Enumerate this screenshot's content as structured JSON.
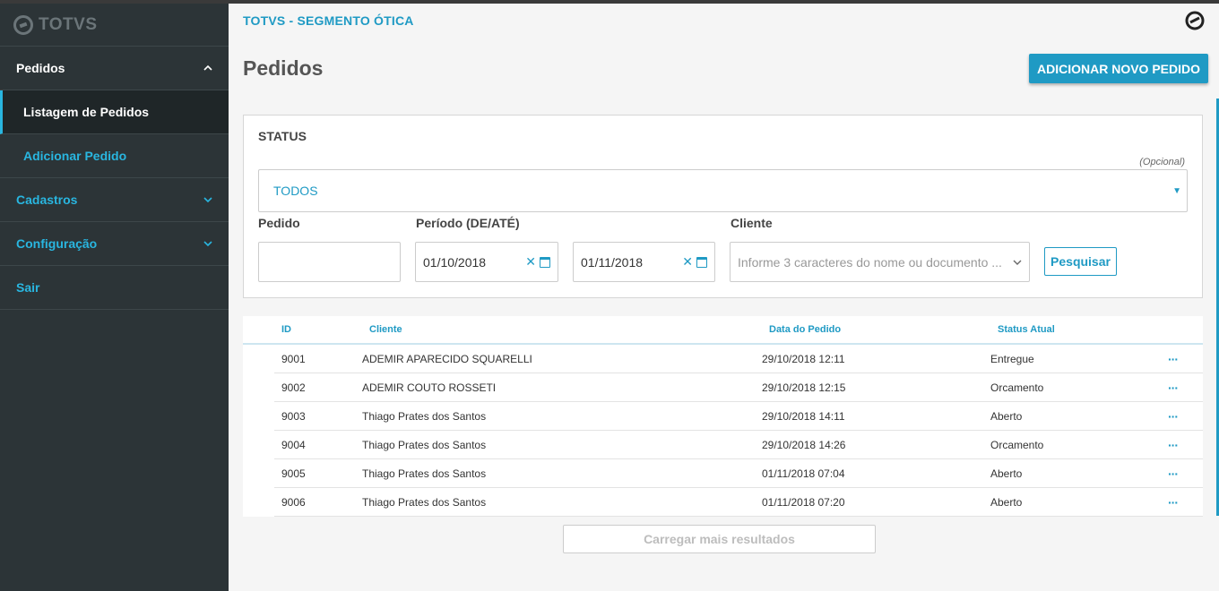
{
  "brand": {
    "logo_text": "TOTVS"
  },
  "sidebar": {
    "items": [
      {
        "label": "Pedidos"
      },
      {
        "label": "Listagem de Pedidos"
      },
      {
        "label": "Adicionar Pedido"
      },
      {
        "label": "Cadastros"
      },
      {
        "label": "Configuração"
      },
      {
        "label": "Sair"
      }
    ]
  },
  "header": {
    "breadcrumb": "TOTVS - SEGMENTO ÓTICA",
    "page_title": "Pedidos",
    "add_button": "ADICIONAR NOVO PEDIDO"
  },
  "filters": {
    "status_label": "STATUS",
    "optional_hint": "(Opcional)",
    "status_value": "TODOS",
    "order_label": "Pedido",
    "order_value": "",
    "period_label": "Período (DE/ATÉ)",
    "date_from": "01/10/2018",
    "date_to": "01/11/2018",
    "client_label": "Cliente",
    "client_placeholder": "Informe 3 caracteres do nome ou documento ...",
    "search_button": "Pesquisar"
  },
  "table": {
    "columns": [
      "ID",
      "Cliente",
      "Data do Pedido",
      "Status Atual"
    ],
    "rows": [
      {
        "id": "9001",
        "client": "ADEMIR APARECIDO SQUARELLI",
        "date": "29/10/2018 12:11",
        "status": "Entregue"
      },
      {
        "id": "9002",
        "client": "ADEMIR COUTO ROSSETI",
        "date": "29/10/2018 12:15",
        "status": "Orcamento"
      },
      {
        "id": "9003",
        "client": "Thiago Prates dos Santos",
        "date": "29/10/2018 14:11",
        "status": "Aberto"
      },
      {
        "id": "9004",
        "client": "Thiago Prates dos Santos",
        "date": "29/10/2018 14:26",
        "status": "Orcamento"
      },
      {
        "id": "9005",
        "client": "Thiago Prates dos Santos",
        "date": "01/11/2018 07:04",
        "status": "Aberto"
      },
      {
        "id": "9006",
        "client": "Thiago Prates dos Santos",
        "date": "01/11/2018 07:20",
        "status": "Aberto"
      }
    ],
    "row_action": "···"
  },
  "load_more": "Carregar mais resultados",
  "colors": {
    "accent": "#1f9ac4",
    "sidebar_bg": "#2c3437"
  },
  "icons": [
    "totvs-logo-icon",
    "chevron-up-icon",
    "chevron-down-icon",
    "help-icon",
    "calendar-icon",
    "clear-icon",
    "more-icon"
  ]
}
